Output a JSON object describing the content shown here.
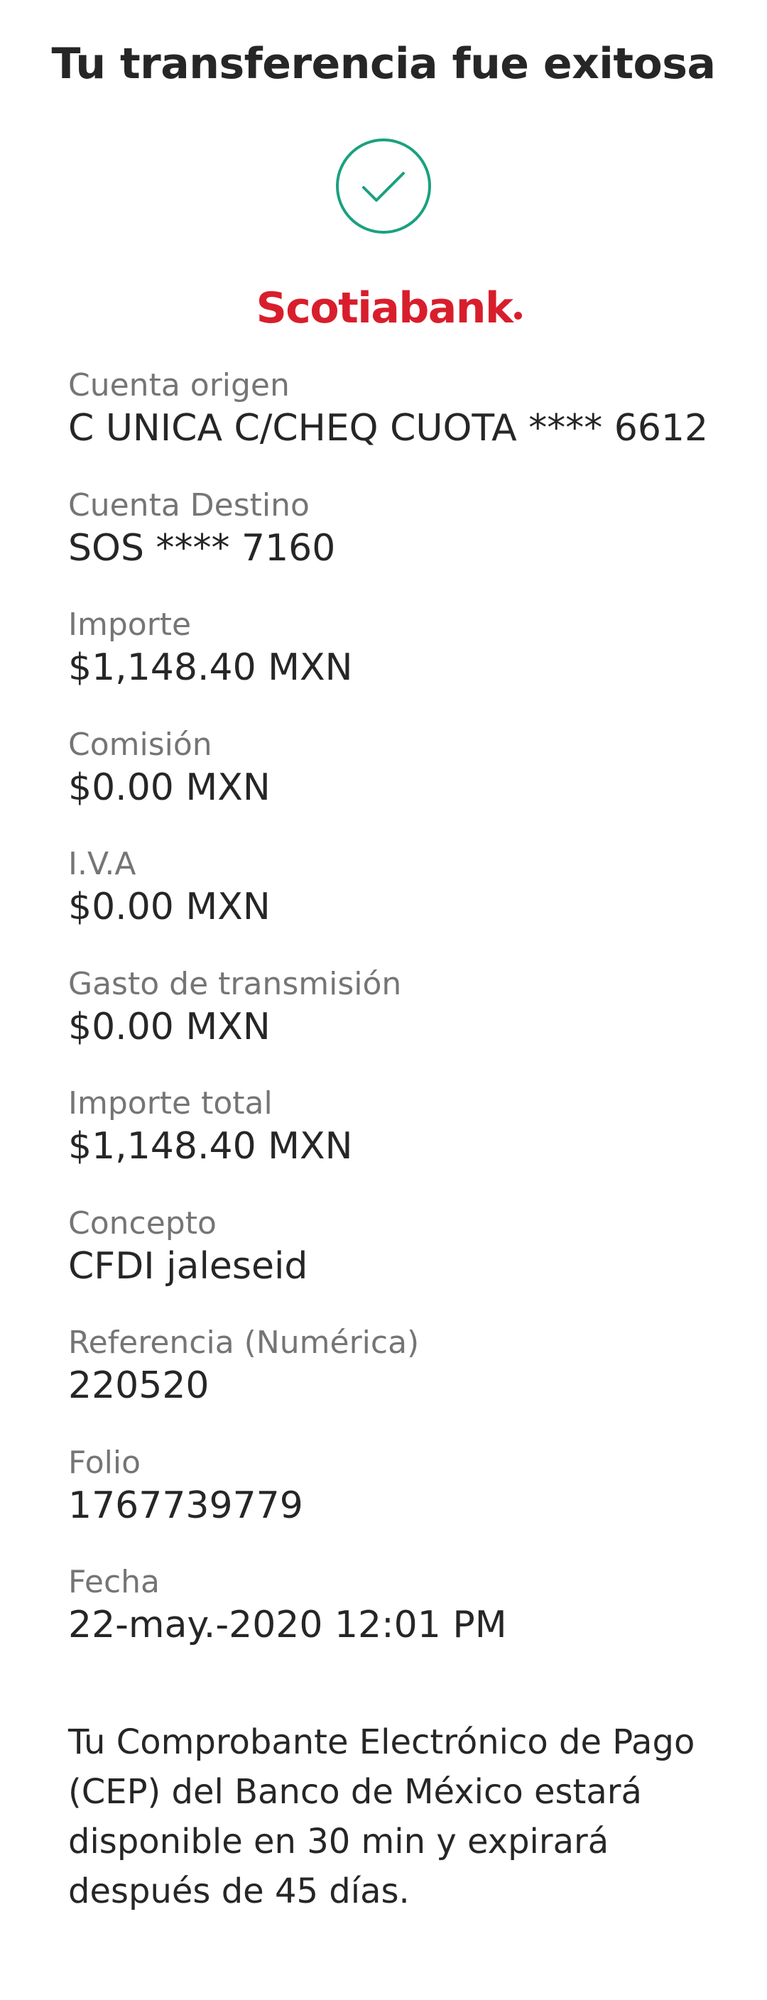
{
  "header": {
    "title": "Tu transferencia fue exitosa"
  },
  "status": {
    "icon": "check-circle-icon",
    "color": "#1aa17f"
  },
  "brand": {
    "name": "Scotiabank",
    "color": "#d81e2c"
  },
  "details": [
    {
      "label": "Cuenta origen",
      "value": "C UNICA C/CHEQ CUOTA **** 6612"
    },
    {
      "label": "Cuenta Destino",
      "value": "SOS **** 7160"
    },
    {
      "label": "Importe",
      "value": "$1,148.40 MXN"
    },
    {
      "label": "Comisión",
      "value": "$0.00 MXN"
    },
    {
      "label": "I.V.A",
      "value": "$0.00 MXN"
    },
    {
      "label": "Gasto de transmisión",
      "value": "$0.00 MXN"
    },
    {
      "label": "Importe total",
      "value": "$1,148.40 MXN"
    },
    {
      "label": "Concepto",
      "value": "CFDI jaleseid"
    },
    {
      "label": "Referencia (Numérica)",
      "value": "220520"
    },
    {
      "label": "Folio",
      "value": "1767739779"
    },
    {
      "label": "Fecha",
      "value": "22-may.-2020 12:01 PM"
    }
  ],
  "notice": {
    "text": "Tu Comprobante Electrónico de Pago (CEP) del Banco de México estará disponible en 30 min y expirará después de 45 días."
  }
}
